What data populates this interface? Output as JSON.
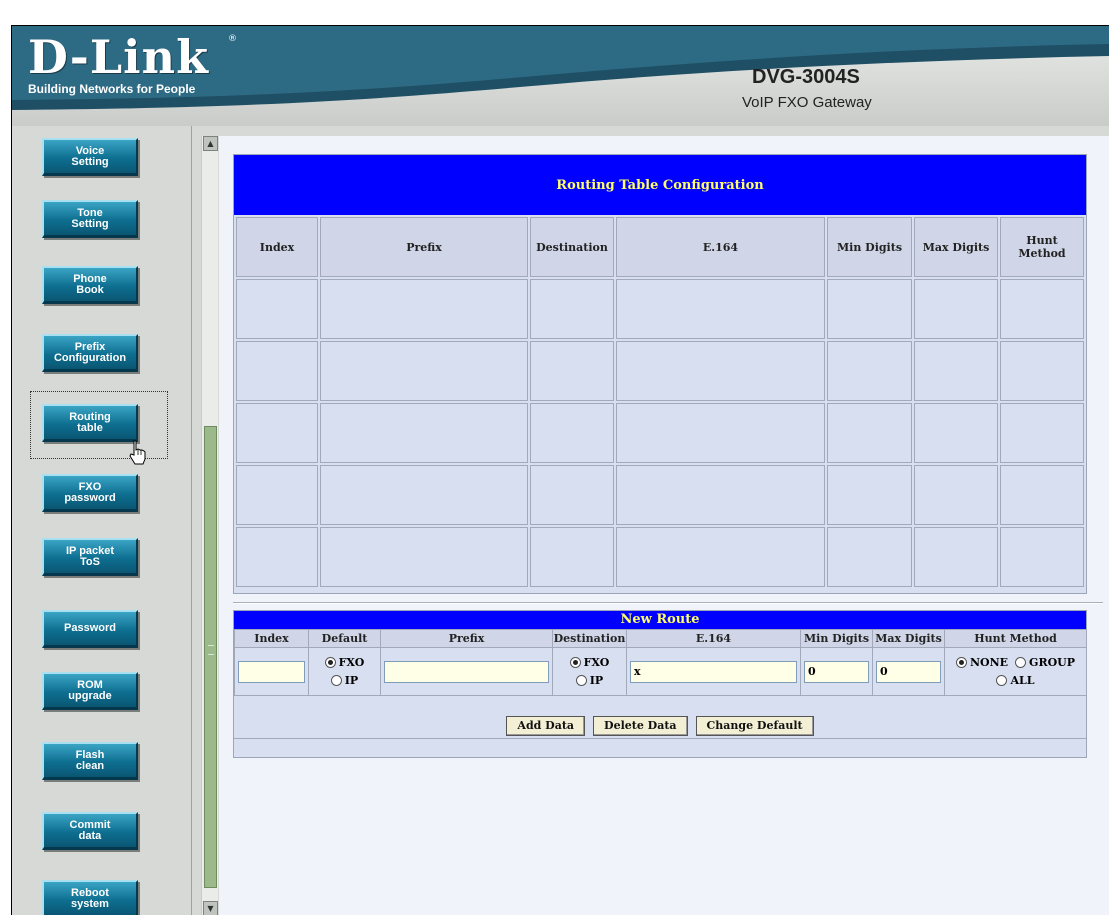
{
  "header": {
    "logo": "D-Link",
    "logo_registered": "®",
    "tagline": "Building Networks for People",
    "product_model": "DVG-3004S",
    "product_description": "VoIP FXO Gateway"
  },
  "sidebar": {
    "items": [
      {
        "label": "Voice\nSetting"
      },
      {
        "label": "Tone\nSetting"
      },
      {
        "label": "Phone\nBook"
      },
      {
        "label": "Prefix\nConfiguration"
      },
      {
        "label": "Routing\ntable"
      },
      {
        "label": "FXO\npassword"
      },
      {
        "label": "IP packet\nToS"
      },
      {
        "label": "Password"
      },
      {
        "label": "ROM\nupgrade"
      },
      {
        "label": "Flash\nclean"
      },
      {
        "label": "Commit\ndata"
      },
      {
        "label": "Reboot\nsystem"
      }
    ],
    "selected": "Routing table"
  },
  "routing_table": {
    "title": "Routing Table Configuration",
    "columns": [
      "Index",
      "Prefix",
      "Destination",
      "E.164",
      "Min Digits",
      "Max Digits",
      "Hunt Method"
    ]
  },
  "new_route": {
    "title": "New Route",
    "columns": [
      "Index",
      "Default",
      "Prefix",
      "Destination",
      "E.164",
      "Min Digits",
      "Max Digits",
      "Hunt Method"
    ],
    "values": {
      "index": "",
      "prefix": "",
      "e164": "x",
      "min_digits": "0",
      "max_digits": "0"
    },
    "default_options": [
      "FXO",
      "IP"
    ],
    "default_selected": "FXO",
    "destination_options": [
      "FXO",
      "IP"
    ],
    "destination_selected": "FXO",
    "hunt_options": [
      "NONE",
      "GROUP",
      "ALL"
    ],
    "hunt_selected": "NONE",
    "buttons": {
      "add": "Add Data",
      "delete": "Delete Data",
      "change_default": "Change Default"
    }
  },
  "colors": {
    "title_bar": "#0000ff",
    "title_text": "#ffff66",
    "nav_button": "#0e6f91",
    "scroll_thumb": "#9cb98b"
  }
}
